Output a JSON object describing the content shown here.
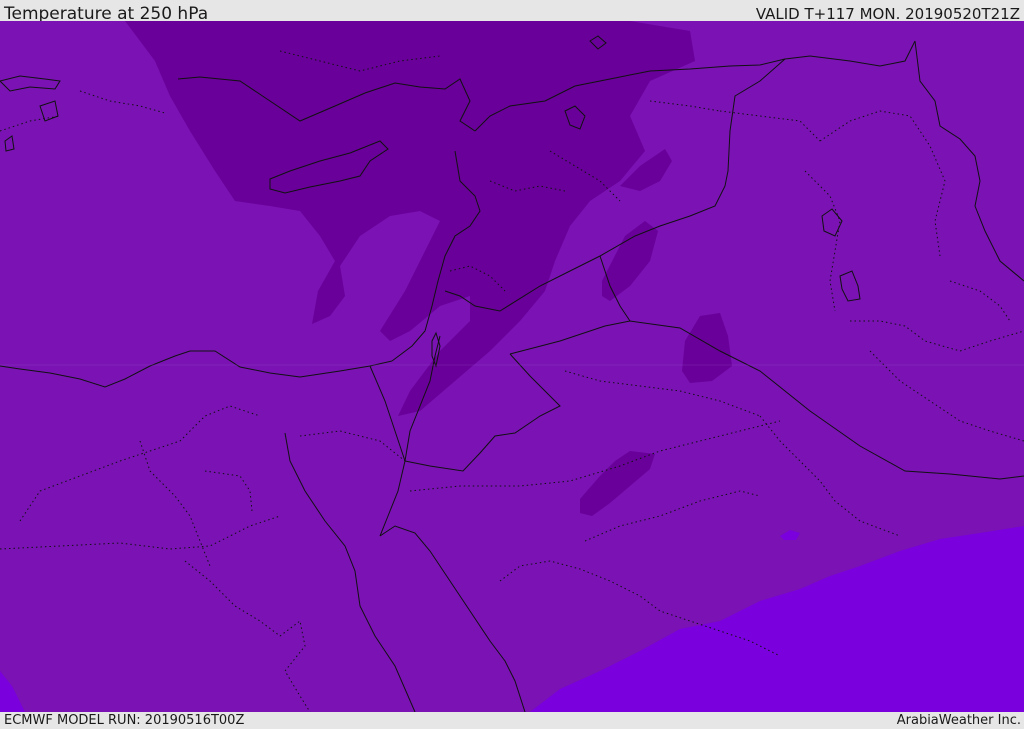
{
  "header": {
    "title": "Temperature at 250 hPa",
    "valid": "VALID T+117 MON. 20190520T21Z"
  },
  "footer": {
    "model_run": "ECMWF MODEL RUN: 20190516T00Z",
    "credit": "ArabiaWeather Inc."
  },
  "map": {
    "colors": {
      "base": "#7a12b4",
      "cold": "#690099",
      "warm": "#7a00dd",
      "border": "#111111"
    }
  }
}
